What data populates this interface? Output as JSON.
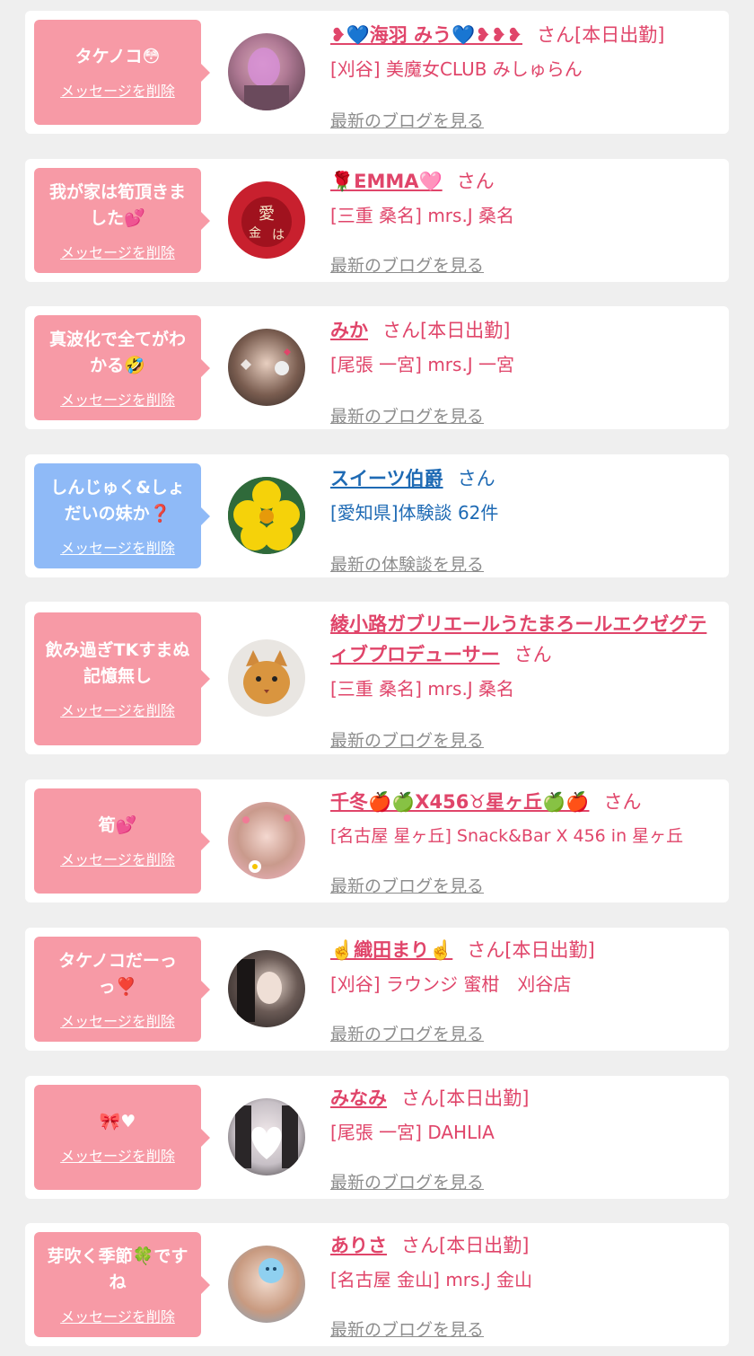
{
  "colors": {
    "pink_bubble": "#f79aa6",
    "blue_bubble": "#8fbaf7",
    "name_pink": "#e0456a",
    "name_blue": "#1e6ab4",
    "link_gray": "#8d8d8d",
    "page_bg": "#efefef"
  },
  "entries": [
    {
      "message": "タケノコ😳",
      "delete_label": "メッセージを削除",
      "name": "❥💙海羽 みう💙❥❥❥",
      "suffix": "さん[本日出勤]",
      "shop": "[刈谷] 美魔女CLUB みしゅらん",
      "link": "最新のブログを見る",
      "avatar_icon": "avatar-photo"
    },
    {
      "message": "我が家は筍頂きました💕",
      "delete_label": "メッセージを削除",
      "name": "🌹EMMA🩷",
      "suffix": "さん",
      "shop": "[三重 桑名] mrs.J 桑名",
      "link": "最新のブログを見る",
      "avatar_icon": "avatar-photo"
    },
    {
      "message": "真波化で全てがわかる🤣",
      "delete_label": "メッセージを削除",
      "name": "みか",
      "suffix": "さん[本日出勤]",
      "shop": "[尾張 一宮] mrs.J 一宮",
      "link": "最新のブログを見る",
      "avatar_icon": "avatar-photo"
    },
    {
      "message": "しんじゅく&しょだいの妹か❓",
      "delete_label": "メッセージを削除",
      "name": "スイーツ伯爵",
      "suffix": "さん",
      "shop": "[愛知県]体験談 62件",
      "link": "最新の体験談を見る",
      "avatar_icon": "avatar-flower"
    },
    {
      "message": "飲み過ぎTKすまぬ記憶無し",
      "delete_label": "メッセージを削除",
      "name": "綾小路ガブリエールうたまろールエクゼグティブプロデューサー",
      "suffix": "さん",
      "shop": "[三重 桑名] mrs.J 桑名",
      "link": "最新のブログを見る",
      "avatar_icon": "avatar-cat"
    },
    {
      "message": "筍💕",
      "delete_label": "メッセージを削除",
      "name": "千冬🍎🍏X456♉星ヶ丘🍏🍎",
      "suffix": "さん",
      "shop": "[名古屋 星ヶ丘] Snack&Bar X 456 in 星ヶ丘",
      "link": "最新のブログを見る",
      "avatar_icon": "avatar-photo"
    },
    {
      "message": "タケノコだーっっ❣️",
      "delete_label": "メッセージを削除",
      "name": "☝️織田まり☝️",
      "suffix": "さん[本日出勤]",
      "shop": "[刈谷] ラウンジ 蜜柑　刈谷店",
      "link": "最新のブログを見る",
      "avatar_icon": "avatar-photo"
    },
    {
      "message": "🎀♥",
      "delete_label": "メッセージを削除",
      "name": "みなみ",
      "suffix": "さん[本日出勤]",
      "shop": "[尾張 一宮] DAHLIA",
      "link": "最新のブログを見る",
      "avatar_icon": "avatar-photo"
    },
    {
      "message": "芽吹く季節🍀ですね",
      "delete_label": "メッセージを削除",
      "name": "ありさ",
      "suffix": "さん[本日出勤]",
      "shop": "[名古屋 金山] mrs.J 金山",
      "link": "最新のブログを見る",
      "avatar_icon": "avatar-photo"
    }
  ]
}
